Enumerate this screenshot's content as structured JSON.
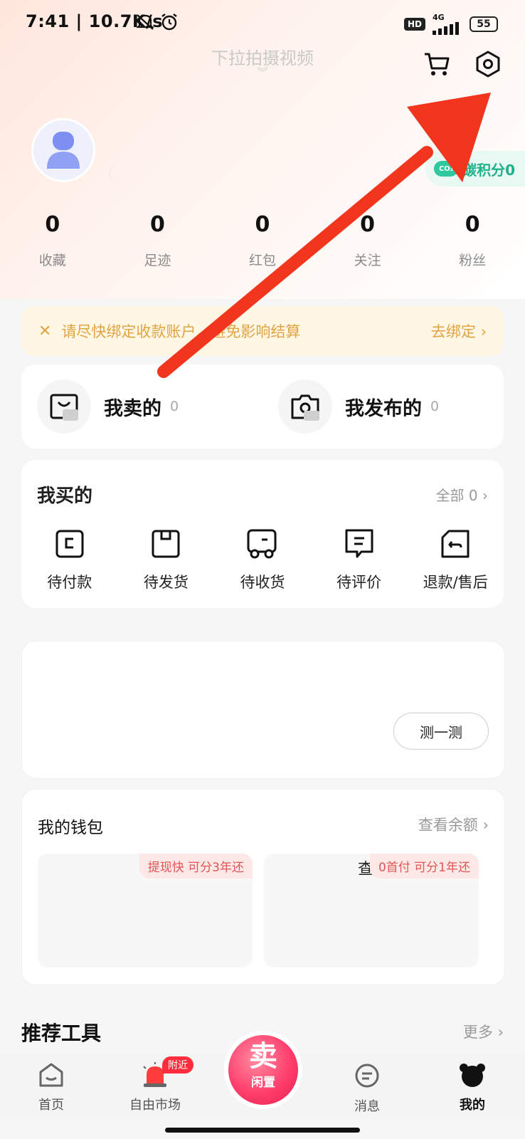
{
  "status_bar": {
    "time": "7:41 | 10.7K/s",
    "hd_label": "HD",
    "network_label": "4G",
    "battery": "55"
  },
  "header": {
    "pull_hint": "下拉拍摄视频",
    "cart_icon": "cart-icon",
    "settings_icon": "settings-hexagon-icon"
  },
  "profile": {
    "avatar_icon": "default-avatar-icon",
    "carbon_label": "碳积分0",
    "carbon_badge": "CO₂"
  },
  "stats": [
    {
      "value": "0",
      "label": "收藏"
    },
    {
      "value": "0",
      "label": "足迹"
    },
    {
      "value": "0",
      "label": "红包"
    },
    {
      "value": "0",
      "label": "关注"
    },
    {
      "value": "0",
      "label": "粉丝"
    }
  ],
  "banner": {
    "message": "请尽快绑定收款账户，避免影响结算",
    "action": "去绑定 ›"
  },
  "sell_publish": [
    {
      "title": "我卖的",
      "count": "0",
      "icon": "shopping-bag-icon"
    },
    {
      "title": "我发布的",
      "count": "0",
      "icon": "camera-icon"
    }
  ],
  "bought": {
    "title": "我买的",
    "all_link": "全部 0 ›",
    "items": [
      {
        "label": "待付款",
        "icon": "wallet-card-icon"
      },
      {
        "label": "待发货",
        "icon": "package-box-icon"
      },
      {
        "label": "待收货",
        "icon": "delivery-truck-icon"
      },
      {
        "label": "待评价",
        "icon": "comment-icon"
      },
      {
        "label": "退款/售后",
        "icon": "return-icon"
      }
    ]
  },
  "test_card": {
    "button": "测一测"
  },
  "wallet": {
    "title": "我的钱包",
    "link": "查看余额 ›",
    "box1_tag": "提现快 可分3年还",
    "box2_prefix": "查",
    "box2_tag": "0首付 可分1年还"
  },
  "tools": {
    "title": "推荐工具",
    "more": "更多 ›"
  },
  "tabbar": {
    "items": [
      {
        "label": "首页",
        "icon": "home-icon"
      },
      {
        "label": "自由市场",
        "icon": "siren-icon"
      },
      {
        "label": "消息",
        "icon": "message-icon"
      },
      {
        "label": "我的",
        "icon": "bear-avatar-icon"
      }
    ],
    "nearby_badge": "附近",
    "sell_big": "卖",
    "sell_small": "闲置"
  },
  "annotation": {
    "arrow_color": "#f1361d"
  }
}
